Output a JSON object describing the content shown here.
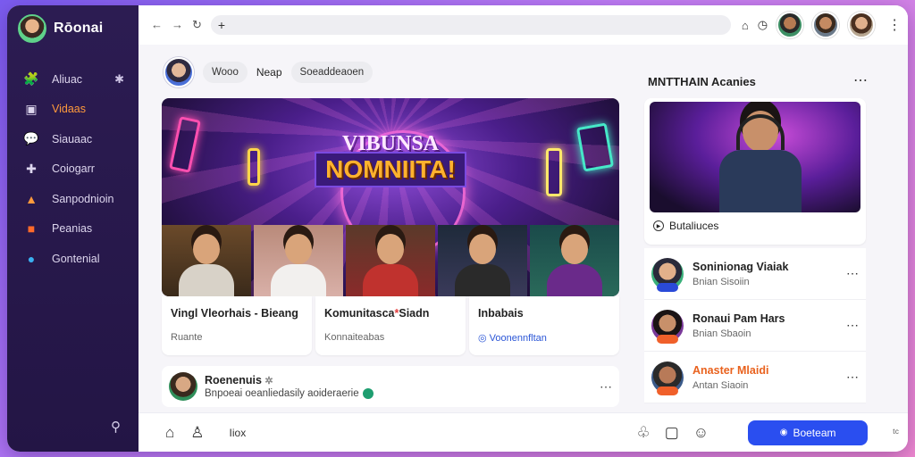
{
  "app": {
    "title": "Rōonai"
  },
  "sidebar": {
    "items": [
      {
        "label": "Aliuac",
        "icon": "puzzle-icon",
        "extra_icon": "pin-icon",
        "active": false
      },
      {
        "label": "Vidaas",
        "icon": "video-icon",
        "active": true
      },
      {
        "label": "Siauaac",
        "icon": "chat-icon",
        "active": false
      },
      {
        "label": "Coiogarr",
        "icon": "gamepad-icon",
        "active": false
      },
      {
        "label": "Sanpodnioin",
        "icon": "triangle-icon",
        "active": false
      },
      {
        "label": "Peanias",
        "icon": "square-badge-icon",
        "active": false
      },
      {
        "label": "Gontenial",
        "icon": "multicolor-circle-icon",
        "active": false
      }
    ],
    "search_icon": "search-icon"
  },
  "topbar": {
    "url_text": "+",
    "icons": [
      "back-arrow-icon",
      "forward-arrow-icon",
      "refresh-icon",
      "bell-icon",
      "clock-icon",
      "kebab-icon"
    ]
  },
  "post": {
    "chip1": "Wooo",
    "text": "Neap",
    "chip2": "Soeaddeaoen",
    "hero_line1": "VIBUNSA",
    "hero_line2": "NOMNIITA!",
    "cards": [
      {
        "title_a": "Vingl Vleorhais",
        "title_b": " - Bieang",
        "sub": "Ruante"
      },
      {
        "title_a": "Komunitasca",
        "title_red": "*",
        "title_b": "Siadn",
        "sub": "Konnaiteabas"
      },
      {
        "title_a": "Inbabais",
        "title_b": "",
        "sub": "Voonennfltan"
      }
    ]
  },
  "comment": {
    "name": "Roenenuis",
    "text": "Bnpoeai oeanliedasily aoideraerie"
  },
  "right_panel": {
    "title": "MNTTHAIN Acanies",
    "video_label": "Butaliuces",
    "items": [
      {
        "name": "Soninionag Viaiak",
        "sub": "Bnian Sisoiin",
        "name_color": "#222222",
        "badge": "blue"
      },
      {
        "name": "Ronaui Pam Hars",
        "sub": "Bnian Sbaoin",
        "name_color": "#222222",
        "badge": "orange"
      },
      {
        "name": "Anaster Mlaidi",
        "sub": "Antan Siaoin",
        "name_color": "#e9621e",
        "badge": "orange"
      }
    ]
  },
  "bottombar": {
    "label": "Iiox",
    "button": "Boeteam",
    "ext_label": "ᵗᶜ"
  },
  "colors": {
    "sidebar_bg": "#2c1c52",
    "accent_orange": "#ff9a3c",
    "primary_blue": "#2a4ef0",
    "background_gradient": [
      "#7b5cf0",
      "#f08ad0"
    ]
  }
}
